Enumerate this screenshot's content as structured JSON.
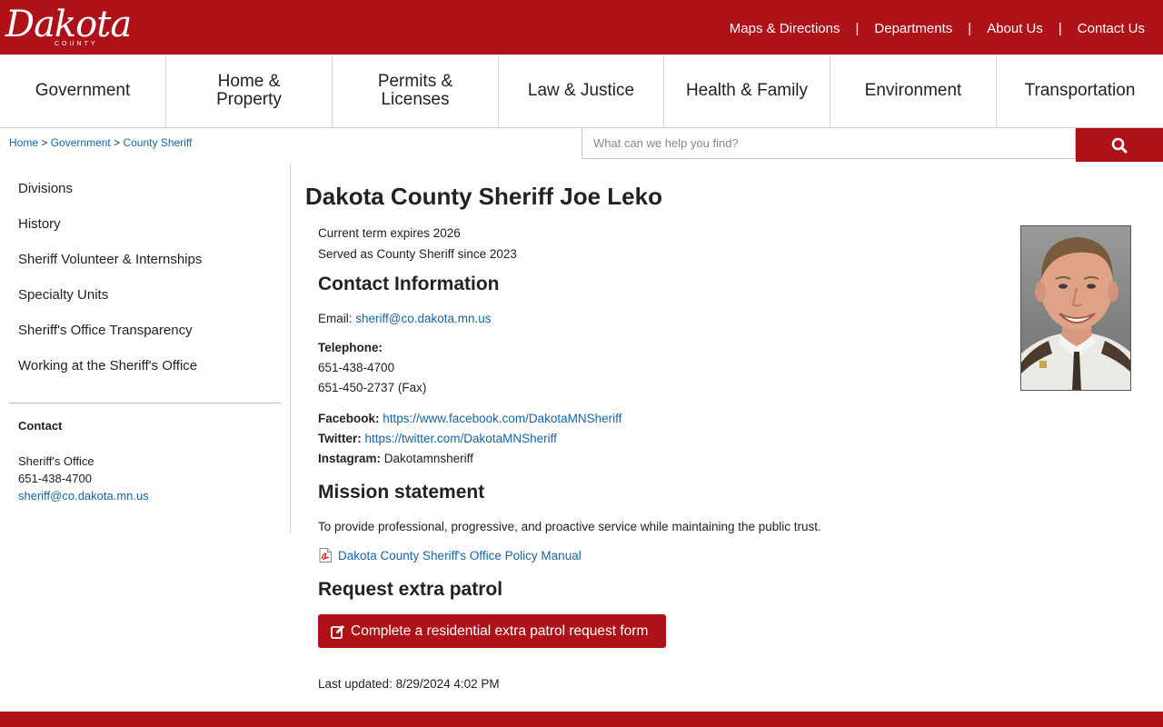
{
  "brand": {
    "logo_text": "Dakota",
    "logo_sub": "COUNTY"
  },
  "top_links": [
    "Maps & Directions",
    "Departments",
    "About Us",
    "Contact Us"
  ],
  "top_sep": "|",
  "main_nav": [
    {
      "line1": "Government",
      "line2": ""
    },
    {
      "line1": "Home &",
      "line2": "Property"
    },
    {
      "line1": "Permits &",
      "line2": "Licenses"
    },
    {
      "line1": "Law & Justice",
      "line2": ""
    },
    {
      "line1": "Health & Family",
      "line2": ""
    },
    {
      "line1": "Environment",
      "line2": ""
    },
    {
      "line1": "Transportation",
      "line2": ""
    }
  ],
  "breadcrumb": {
    "items": [
      "Home",
      "Government",
      "County Sheriff"
    ],
    "sep": ">"
  },
  "search": {
    "placeholder": "What can we help you find?",
    "icon": "search-icon"
  },
  "sidebar": {
    "items": [
      "Divisions",
      "History",
      "Sheriff Volunteer & Internships",
      "Specialty Units",
      "Sheriff's Office Transparency",
      "Working at the Sheriff's Office"
    ],
    "contact_heading": "Contact",
    "contact_name": "Sheriff's Office",
    "contact_phone": "651-438-4700",
    "contact_email": "sheriff@co.dakota.mn.us"
  },
  "content": {
    "title": "Dakota County Sheriff Joe Leko",
    "term_line1": "Current term expires 2026",
    "term_line2": "Served as County Sheriff since 2023",
    "contact_heading": "Contact Information",
    "email_label": "Email:",
    "email_value": "sheriff@co.dakota.mn.us",
    "telephone_label": "Telephone:",
    "phone_main": "651-438-4700",
    "phone_fax": "651-450-2737 (Fax)",
    "facebook_label": "Facebook:",
    "facebook_url": "https://www.facebook.com/DakotaMNSheriff",
    "twitter_label": "Twitter:",
    "twitter_url": "https://twitter.com/DakotaMNSheriff",
    "instagram_label": "Instagram:",
    "instagram_value": "Dakotamnsheriff",
    "mission_heading": "Mission statement",
    "mission_text": "To provide professional, progressive, and proactive service while maintaining the public trust.",
    "policy_link": "Dakota County Sheriff's Office Policy Manual",
    "patrol_heading": "Request extra patrol",
    "patrol_button": "Complete a residential extra patrol request form",
    "last_updated": "Last updated: 8/29/2024 4:02 PM"
  },
  "colors": {
    "brand_red": "#ae1218",
    "link_blue": "#1565a6"
  }
}
